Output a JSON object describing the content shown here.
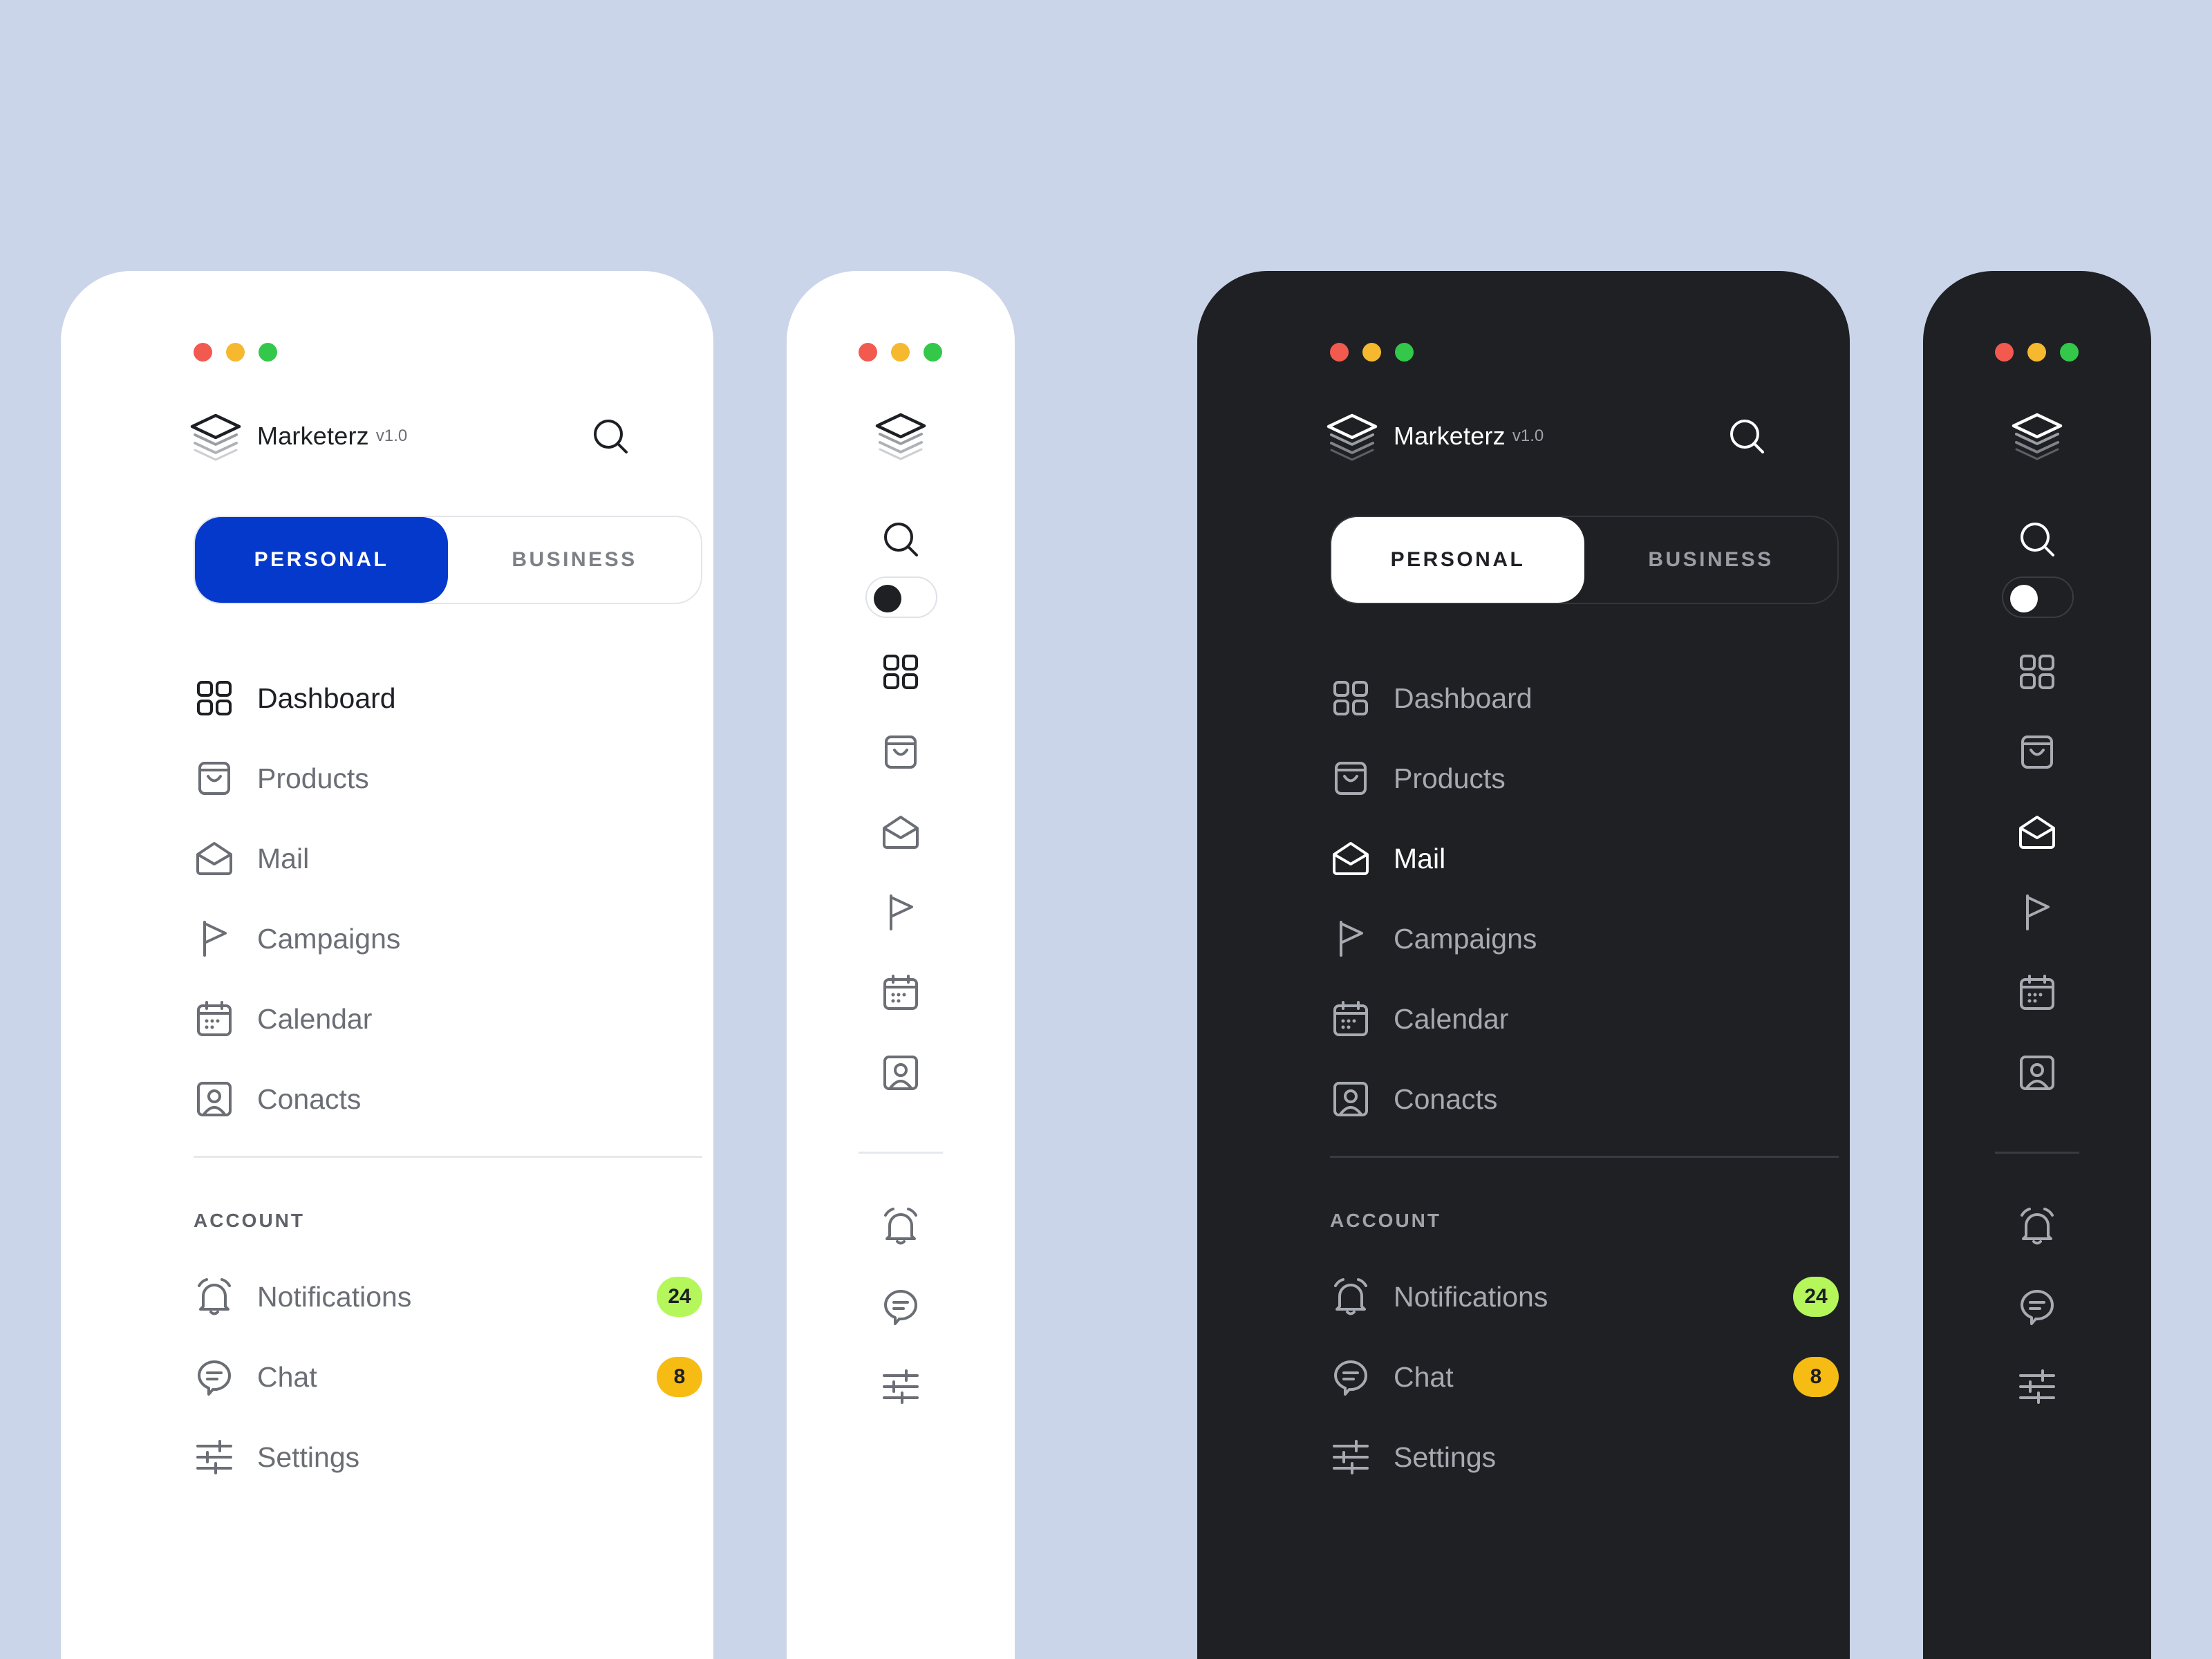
{
  "app": {
    "name": "Marketerz",
    "version": "v1.0"
  },
  "segmented": {
    "personal": "PERSONAL",
    "business": "BUSINESS",
    "selected": "personal"
  },
  "menu": [
    {
      "label": "Dashboard",
      "icon": "grid-icon"
    },
    {
      "label": "Products",
      "icon": "shopping-bag-icon"
    },
    {
      "label": "Mail",
      "icon": "mail-open-icon"
    },
    {
      "label": "Campaigns",
      "icon": "flag-icon"
    },
    {
      "label": "Calendar",
      "icon": "calendar-icon"
    },
    {
      "label": "Conacts",
      "icon": "contact-card-icon"
    }
  ],
  "account": {
    "title": "ACCOUNT",
    "items": [
      {
        "label": "Notifications",
        "icon": "alarm-bell-icon",
        "badge": "24",
        "badge_color": "#b5f75a"
      },
      {
        "label": "Chat",
        "icon": "chat-bubble-icon",
        "badge": "8",
        "badge_color": "#f6bc14"
      },
      {
        "label": "Settings",
        "icon": "sliders-icon"
      }
    ]
  },
  "selected": {
    "light": "Dashboard",
    "dark": "Mail"
  },
  "colors": {
    "background": "#cbd5e9",
    "accent": "#0539cc",
    "light_panel": "#ffffff",
    "dark_panel": "#1e2024"
  }
}
